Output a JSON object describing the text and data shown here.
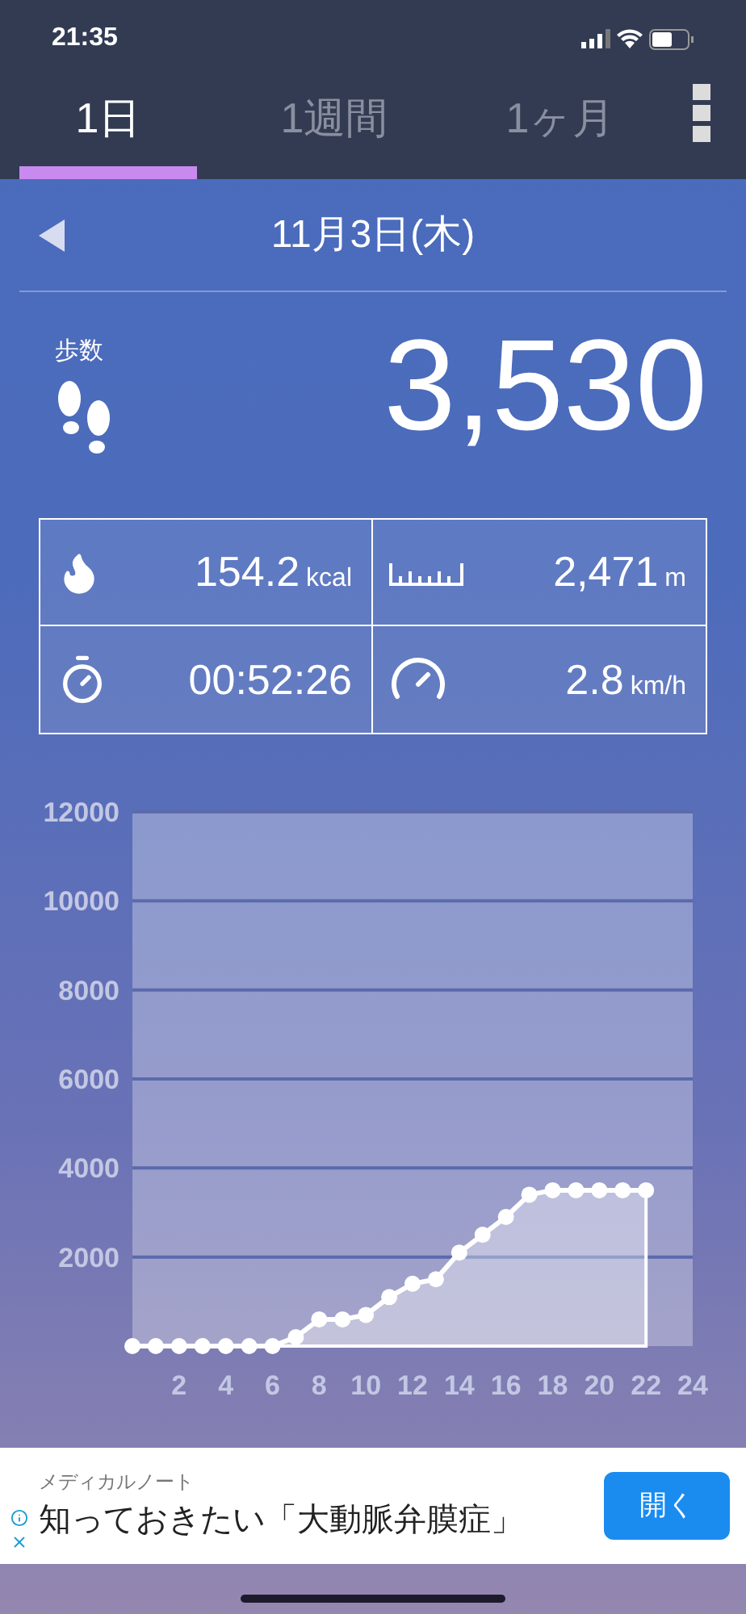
{
  "status_bar": {
    "time": "21:35"
  },
  "tabs": [
    {
      "label": "1日",
      "selected": true
    },
    {
      "label": "1週間",
      "selected": false
    },
    {
      "label": "1ヶ月",
      "selected": false
    }
  ],
  "date_nav": {
    "date": "11月3日(木)"
  },
  "steps": {
    "label": "歩数",
    "value": "3,530"
  },
  "stats": [
    {
      "kind": "calories",
      "value": "154.2",
      "unit": "kcal"
    },
    {
      "kind": "distance",
      "value": "2,471",
      "unit": "m"
    },
    {
      "kind": "time",
      "value": "00:52:26"
    },
    {
      "kind": "speed",
      "value": "2.8",
      "unit": "km/h"
    }
  ],
  "chart": {
    "chart_data": {
      "type": "area",
      "x": [
        0,
        1,
        2,
        3,
        4,
        5,
        6,
        7,
        8,
        9,
        10,
        11,
        12,
        13,
        14,
        15,
        16,
        17,
        18,
        19,
        20,
        21,
        22
      ],
      "series": [
        {
          "color": "#ffffff",
          "values": [
            0,
            0,
            0,
            0,
            0,
            0,
            0,
            200,
            600,
            600,
            700,
            1100,
            1400,
            1500,
            2100,
            2500,
            2900,
            3400,
            3500,
            3500,
            3500,
            3500,
            3500
          ]
        }
      ],
      "grid": true,
      "xlim": [
        0,
        24
      ],
      "ylim": [
        0,
        12000
      ],
      "xticks": [
        2,
        4,
        6,
        8,
        10,
        12,
        14,
        16,
        18,
        20,
        22,
        24
      ],
      "yticks": [
        2000,
        4000,
        6000,
        8000,
        10000,
        12000
      ]
    }
  },
  "ad": {
    "source": "メディカルノート",
    "headline": "知っておきたい「大動脈弁膜症」",
    "button": "開く"
  }
}
